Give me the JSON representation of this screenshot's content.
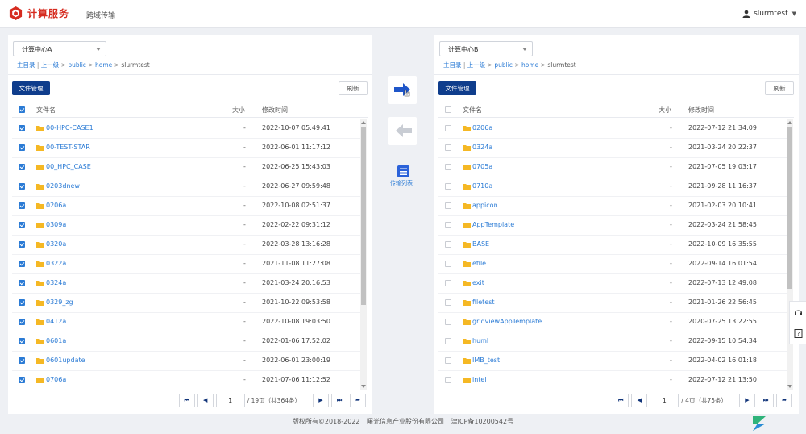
{
  "header": {
    "brand": "计算服务",
    "subtitle": "跨域传输",
    "user": "slurmtest"
  },
  "left": {
    "center": "计算中心A",
    "breadcrumb": {
      "root": "主目录",
      "sep1": " | ",
      "up": "上一级",
      "sep2": " > ",
      "p1": "public",
      "sep3": " > ",
      "p2": "home",
      "sep4": " > ",
      "cur": "slurmtest"
    },
    "manage_label": "文件管理",
    "refresh_label": "刷新",
    "columns": {
      "name": "文件名",
      "size": "大小",
      "time": "修改时间"
    },
    "files": [
      {
        "name": "00-HPC-CASE1",
        "size": "-",
        "time": "2022-10-07 05:49:41"
      },
      {
        "name": "00-TEST-STAR",
        "size": "-",
        "time": "2022-06-01 11:17:12"
      },
      {
        "name": "00_HPC_CASE",
        "size": "-",
        "time": "2022-06-25 15:43:03"
      },
      {
        "name": "0203dnew",
        "size": "-",
        "time": "2022-06-27 09:59:48"
      },
      {
        "name": "0206a",
        "size": "-",
        "time": "2022-10-08 02:51:37"
      },
      {
        "name": "0309a",
        "size": "-",
        "time": "2022-02-22 09:31:12"
      },
      {
        "name": "0320a",
        "size": "-",
        "time": "2022-03-28 13:16:28"
      },
      {
        "name": "0322a",
        "size": "-",
        "time": "2021-11-08 11:27:08"
      },
      {
        "name": "0324a",
        "size": "-",
        "time": "2021-03-24 20:16:53"
      },
      {
        "name": "0329_zg",
        "size": "-",
        "time": "2021-10-22 09:53:58"
      },
      {
        "name": "0412a",
        "size": "-",
        "time": "2022-10-08 19:03:50"
      },
      {
        "name": "0601a",
        "size": "-",
        "time": "2022-01-06 17:52:02"
      },
      {
        "name": "0601update",
        "size": "-",
        "time": "2022-06-01 23:00:19"
      },
      {
        "name": "0706a",
        "size": "-",
        "time": "2021-07-06 11:12:52"
      }
    ],
    "pager": {
      "page": "1",
      "info": "/ 19页（共364条）"
    }
  },
  "right": {
    "center": "计算中心B",
    "breadcrumb": {
      "root": "主目录",
      "sep1": " | ",
      "up": "上一级",
      "sep2": " > ",
      "p1": "public",
      "sep3": " > ",
      "p2": "home",
      "sep4": " > ",
      "cur": "slurmtest"
    },
    "manage_label": "文件管理",
    "refresh_label": "刷新",
    "columns": {
      "name": "文件名",
      "size": "大小",
      "time": "修改时间"
    },
    "files": [
      {
        "name": "0206a",
        "size": "-",
        "time": "2022-07-12 21:34:09"
      },
      {
        "name": "0324a",
        "size": "-",
        "time": "2021-03-24 20:22:37"
      },
      {
        "name": "0705a",
        "size": "-",
        "time": "2021-07-05 19:03:17"
      },
      {
        "name": "0710a",
        "size": "-",
        "time": "2021-09-28 11:16:37"
      },
      {
        "name": "appicon",
        "size": "-",
        "time": "2021-02-03 20:10:41"
      },
      {
        "name": "AppTemplate",
        "size": "-",
        "time": "2022-03-24 21:58:45"
      },
      {
        "name": "BASE",
        "size": "-",
        "time": "2022-10-09 16:35:55"
      },
      {
        "name": "efile",
        "size": "-",
        "time": "2022-09-14 16:01:54"
      },
      {
        "name": "exit",
        "size": "-",
        "time": "2022-07-13 12:49:08"
      },
      {
        "name": "filetest",
        "size": "-",
        "time": "2021-01-26 22:56:45"
      },
      {
        "name": "gridviewAppTemplate",
        "size": "-",
        "time": "2020-07-25 13:22:55"
      },
      {
        "name": "huml",
        "size": "-",
        "time": "2022-09-15 10:54:34"
      },
      {
        "name": "IMB_test",
        "size": "-",
        "time": "2022-04-02 16:01:18"
      },
      {
        "name": "intel",
        "size": "-",
        "time": "2022-07-12 21:13:50"
      }
    ],
    "pager": {
      "page": "1",
      "info": "/ 4页（共75条）"
    }
  },
  "middle": {
    "transfer_list_label": "传输列表"
  },
  "footer": {
    "copyright": "版权所有©2018-2022",
    "company": "曙光信息产业股份有限公司",
    "icp": "津ICP备10200542号"
  },
  "colors": {
    "brand": "#d62b1f",
    "primary": "#0f3d8c",
    "link": "#2b7bd5",
    "folder": "#f5b824"
  }
}
